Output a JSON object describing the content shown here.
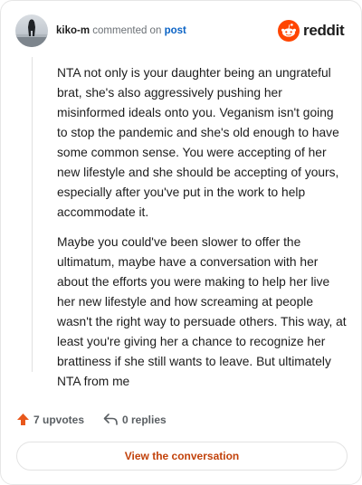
{
  "header": {
    "username": "kiko-m",
    "action_text": "commented on",
    "post_link": "post",
    "brand_icon": "reddit-snoo-icon",
    "brand_name": "reddit"
  },
  "comment": {
    "paragraphs": [
      "NTA not only is your daughter being an ungrateful brat, she's also aggressively pushing her misinformed ideals onto you. Veganism isn't going to stop the pandemic and she's old enough to have some common sense. You were accepting of her new lifestyle and she should be accepting of yours, especially after you've put in the work to help accommodate it.",
      "Maybe you could've been slower to offer the ultimatum, maybe have a conversation with her about the efforts you were making to help her live her new lifestyle and how screaming at people wasn't the right way to persuade others. This way, at least you're giving her a chance to recognize her brattiness if she still wants to leave. But ultimately NTA from me"
    ]
  },
  "stats": {
    "upvotes_label": "7 upvotes",
    "upvote_icon": "upvote-arrow-icon",
    "replies_label": "0 replies",
    "reply_icon": "reply-arrow-icon"
  },
  "cta": {
    "label": "View the conversation"
  },
  "colors": {
    "accent": "#c2420b",
    "brand": "#ff4500",
    "link": "#0b63c5"
  }
}
